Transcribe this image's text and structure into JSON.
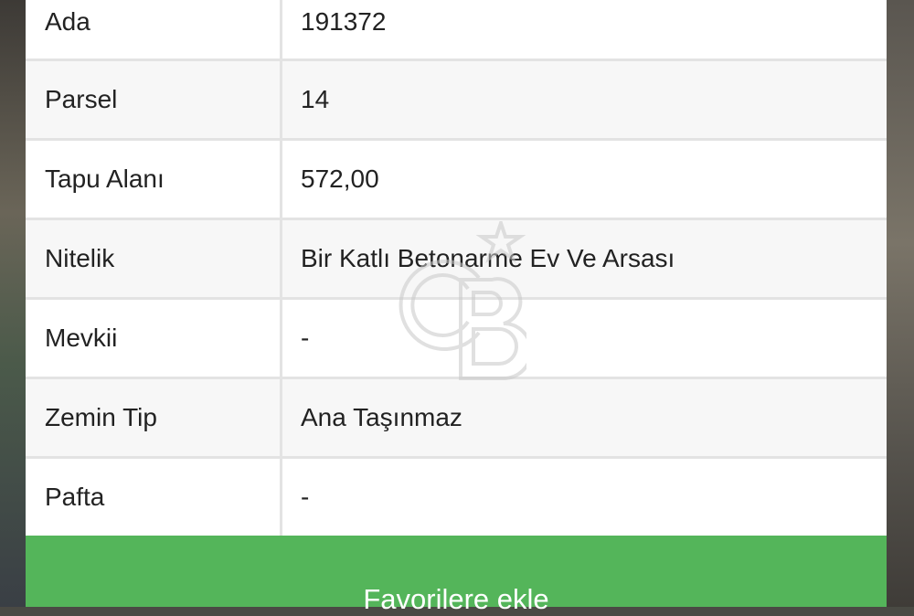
{
  "details": {
    "rows": [
      {
        "label": "Ada",
        "value": "191372"
      },
      {
        "label": "Parsel",
        "value": "14"
      },
      {
        "label": "Tapu Alanı",
        "value": "572,00"
      },
      {
        "label": "Nitelik",
        "value": "Bir Katlı Betonarme Ev Ve Arsası"
      },
      {
        "label": "Mevkii",
        "value": "-"
      },
      {
        "label": "Zemin Tip",
        "value": "Ana Taşınmaz"
      },
      {
        "label": "Pafta",
        "value": "-"
      }
    ]
  },
  "actions": {
    "favorite_label": "Favorilere ekle",
    "favorite_color": "#54b55a"
  },
  "watermark": {
    "icon": "cb-logo-icon",
    "text": "CB"
  }
}
